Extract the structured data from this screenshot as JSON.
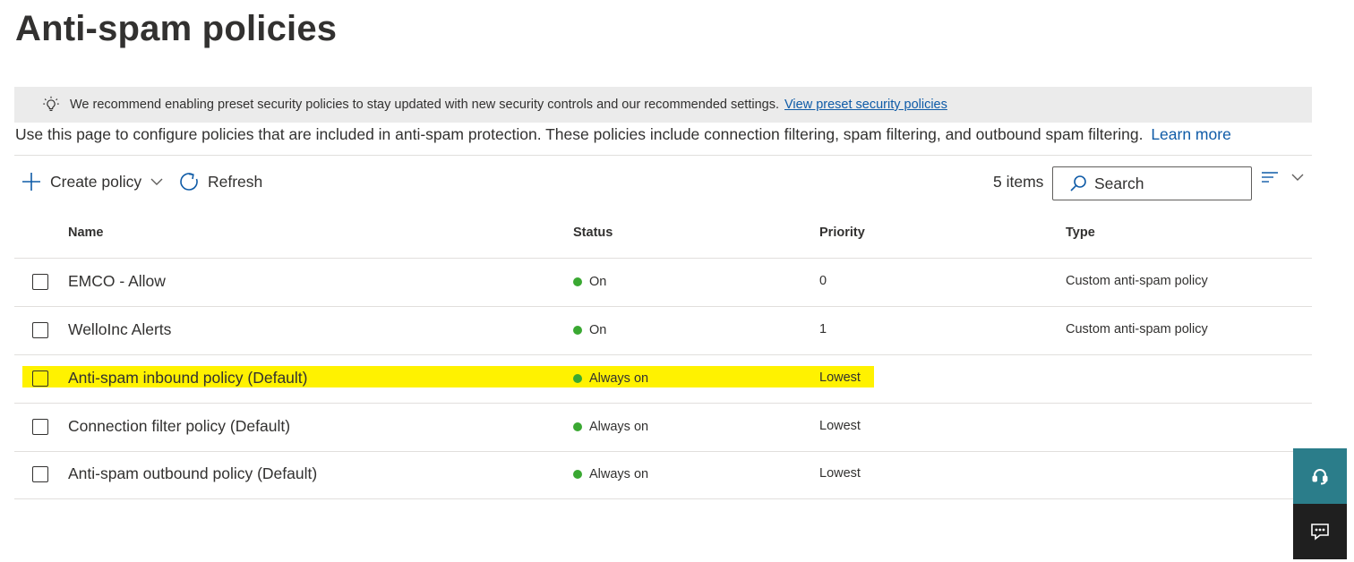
{
  "page": {
    "title": "Anti-spam policies"
  },
  "banner": {
    "icon": "lightbulb-icon",
    "text": "We recommend enabling preset security policies to stay updated with new security controls and our recommended settings.",
    "link_label": "View preset security policies"
  },
  "intro": {
    "text": "Use this page to configure policies that are included in anti-spam protection. These policies include connection filtering, spam filtering, and outbound spam filtering.",
    "link_label": "Learn more"
  },
  "toolbar": {
    "create_label": "Create policy",
    "refresh_label": "Refresh",
    "items_count": "5 items",
    "search_placeholder": "Search"
  },
  "table": {
    "columns": [
      "Name",
      "Status",
      "Priority",
      "Type"
    ],
    "rows": [
      {
        "name": "EMCO - Allow",
        "status": "On",
        "priority": "0",
        "type": "Custom anti-spam policy",
        "highlighted": false
      },
      {
        "name": "WelloInc Alerts",
        "status": "On",
        "priority": "1",
        "type": "Custom anti-spam policy",
        "highlighted": false
      },
      {
        "name": "Anti-spam inbound policy (Default)",
        "status": "Always on",
        "priority": "Lowest",
        "type": "",
        "highlighted": true
      },
      {
        "name": "Connection filter policy (Default)",
        "status": "Always on",
        "priority": "Lowest",
        "type": "",
        "highlighted": false
      },
      {
        "name": "Anti-spam outbound policy (Default)",
        "status": "Always on",
        "priority": "Lowest",
        "type": "",
        "highlighted": false
      }
    ]
  },
  "colors": {
    "status_on": "#3aa832",
    "link": "#0f5ba7",
    "highlight": "#fff200",
    "help_button": "#2b7d8a",
    "feedback_button": "#1f1f1f"
  },
  "side_buttons": {
    "help_icon": "headset-icon",
    "feedback_icon": "feedback-icon"
  }
}
